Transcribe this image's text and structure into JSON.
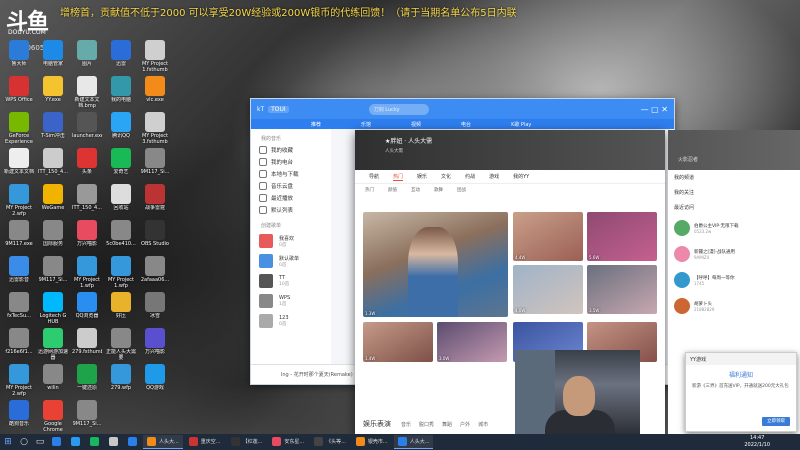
{
  "stream": {
    "logo_text": "斗鱼",
    "logo_sub": "DOUYU.COM",
    "view_count": "10605",
    "marquee": "增榜首，贡献值不低于2000 可以享受20W经验或200W银币的代练回馈！（请于当期名单公布5日内联"
  },
  "desktop_icons": [
    {
      "label": "鲁大师",
      "color": "#2b7bd8"
    },
    {
      "label": "电脑管家",
      "color": "#1d8ae8"
    },
    {
      "label": "图片",
      "color": "#6aa"
    },
    {
      "label": "迅雷",
      "color": "#2a6dd8"
    },
    {
      "label": "MY Project 1.fsthumb",
      "color": "#cfcfcf"
    },
    {
      "label": "WPS Office",
      "color": "#d63232"
    },
    {
      "label": "YY.exe",
      "color": "#f4c430"
    },
    {
      "label": "新建文本文档.bmp",
      "color": "#e8e8e8"
    },
    {
      "label": "我的电脑",
      "color": "#39a"
    },
    {
      "label": "vlc.exe",
      "color": "#f28b1a"
    },
    {
      "label": "GeForce Experience",
      "color": "#76b900"
    },
    {
      "label": "T-Sim冲击",
      "color": "#3a64c8"
    },
    {
      "label": "launcher.exe",
      "color": "#555"
    },
    {
      "label": "腾讯QQ",
      "color": "#2aa4f4"
    },
    {
      "label": "MY Project 3.fsthumb",
      "color": "#cfcfcf"
    },
    {
      "label": "新建文本文档",
      "color": "#eee"
    },
    {
      "label": "ITT_150_4...",
      "color": "#ccc"
    },
    {
      "label": "头条",
      "color": "#d33"
    },
    {
      "label": "爱奇艺",
      "color": "#19b955"
    },
    {
      "label": "9M117_Si...",
      "color": "#888"
    },
    {
      "label": "MY Project 2.wfp",
      "color": "#3498db"
    },
    {
      "label": "WeGame",
      "color": "#f0b400"
    },
    {
      "label": "ITT_150_4...",
      "color": "#999"
    },
    {
      "label": "回收站",
      "color": "#ddd"
    },
    {
      "label": "战争雷霆",
      "color": "#b33"
    },
    {
      "label": "9M117.exe",
      "color": "#888"
    },
    {
      "label": "国际服务",
      "color": "#888"
    },
    {
      "label": "万兴喵影",
      "color": "#e84a5f"
    },
    {
      "label": "5c0be410...",
      "color": "#888"
    },
    {
      "label": "OBS Studio",
      "color": "#333"
    },
    {
      "label": "迅雷影音",
      "color": "#3b8be8"
    },
    {
      "label": "9M117_Si...",
      "color": "#888"
    },
    {
      "label": "MY Project 1.wfp",
      "color": "#3498db"
    },
    {
      "label": "MY Project 1.wfp",
      "color": "#3498db"
    },
    {
      "label": "2afaaa06...",
      "color": "#888"
    },
    {
      "label": "fxTecSu...",
      "color": "#888"
    },
    {
      "label": "Logitech G HUB",
      "color": "#00b8fc"
    },
    {
      "label": "QQ浏览器",
      "color": "#2a8ef0"
    },
    {
      "label": "好压",
      "color": "#e8b32a"
    },
    {
      "label": "冰雪",
      "color": "#777"
    },
    {
      "label": "f216e6f1...",
      "color": "#888"
    },
    {
      "label": "迅游网游加速器",
      "color": "#2ecc71"
    },
    {
      "label": "279.fsthumb",
      "color": "#ccc"
    },
    {
      "label": "正能人头大需要",
      "color": "#888"
    },
    {
      "label": "万兴喵影",
      "color": "#5a4fcf"
    },
    {
      "label": "MY Project 2.wfp",
      "color": "#3498db"
    },
    {
      "label": "wilin",
      "color": "#888"
    },
    {
      "label": "一键还原",
      "color": "#1fa34a"
    },
    {
      "label": "279.wfp",
      "color": "#3498db"
    },
    {
      "label": "QQ游戏",
      "color": "#1e9ae8"
    },
    {
      "label": "酷狗音乐",
      "color": "#2a6dd8"
    },
    {
      "label": "Google Chrome",
      "color": "#e94235"
    },
    {
      "label": "9M117_Si...",
      "color": "#888"
    }
  ],
  "music_window": {
    "app_name": "kT",
    "badge": "TOUI",
    "search_placeholder": "刀剑 Lucky",
    "top_tabs": [
      "推荐",
      "乐馆",
      "视频",
      "电台",
      "K歌 Play"
    ],
    "sidebar_header": "我的音乐",
    "sidebar_items": [
      "我的收藏",
      "我的电台",
      "本地与下载",
      "音乐云盘",
      "最近播放",
      "默认列表"
    ],
    "playlist_header": "创建歌单",
    "playlists": [
      {
        "title": "我喜欢",
        "sub": "0首",
        "color": "#e85a5a"
      },
      {
        "title": "默认歌单",
        "sub": "0首",
        "color": "#4a90e2"
      },
      {
        "title": "TT",
        "sub": "10首",
        "color": "#555"
      },
      {
        "title": "WPS",
        "sub": "1首",
        "color": "#888"
      },
      {
        "title": "123",
        "sub": "0首",
        "color": "#aaa"
      }
    ],
    "footer_song": "lng - 花开时那个夏天(Remake)"
  },
  "live_window": {
    "channel_title": "★胖妞 · 人头大需",
    "channel_sub": "人头大需",
    "main_tabs": [
      "导航",
      "热门",
      "娱乐",
      "文化",
      "约战",
      "游戏",
      "我的YY"
    ],
    "active_tab": "热门",
    "sub_tabs": [
      "热门",
      "颜值",
      "互动",
      "歌舞",
      "团战"
    ],
    "tiles": [
      {
        "caption": "4.4W",
        "color": "linear-gradient(150deg,#c9a08a,#9b5f54)"
      },
      {
        "caption": "5.6W",
        "color": "linear-gradient(150deg,#8e4a72,#c56090)"
      },
      {
        "caption": "4.0W",
        "color": "linear-gradient(150deg,#9fb3c7,#d1c4be)"
      },
      {
        "caption": "3.5W",
        "color": "linear-gradient(150deg,#6a6f7e,#c7a8b0)"
      },
      {
        "caption": "1.4W",
        "color": "linear-gradient(150deg,#c69b88,#7e5048)"
      },
      {
        "caption": "3.0W",
        "color": "linear-gradient(150deg,#5a4c70,#c59ab0)"
      },
      {
        "caption": "2.6W",
        "color": "linear-gradient(150deg,#3a54a0,#6c85d0)"
      },
      {
        "caption": "1.9W",
        "color": "linear-gradient(150deg,#c49484,#85504a)"
      }
    ],
    "big_tile_caption": "1.3W",
    "footer_title": "娱乐表演",
    "footer_tabs": [
      "音乐",
      "脱口秀",
      "舞蹈",
      "户外",
      "城市"
    ]
  },
  "right_panel": {
    "header": "火影忍者",
    "rows": [
      "我的频道",
      "我的关注",
      "最近访问"
    ],
    "users": [
      {
        "name": "伯爵公主VIP·无限下载",
        "meta": "0523.2w",
        "color": "#5a6"
      },
      {
        "name": "新疆之[漫]·战队通用",
        "meta": "9AMIZ4",
        "color": "#e8a"
      },
      {
        "name": "【呼呼】每周一等你",
        "meta": "1745",
        "color": "#39c"
      },
      {
        "name": "胡萝卜头",
        "meta": "21882829",
        "color": "#c63"
      }
    ]
  },
  "popup": {
    "app": "YY游戏",
    "title": "福利通知",
    "body": "新游《三界》首充送VIP，开通就送200元大礼包",
    "button": "立即领取"
  },
  "taskbar": {
    "items": [
      {
        "label": "",
        "color": "#2a7fe8",
        "active": false
      },
      {
        "label": "",
        "color": "#2a9af0",
        "active": false
      },
      {
        "label": "",
        "color": "#18b860",
        "active": false
      },
      {
        "label": "",
        "color": "#c8c8c8",
        "active": false
      },
      {
        "label": "",
        "color": "#2a7fe8",
        "active": false
      },
      {
        "label": "人头大...",
        "color": "#f28b1a",
        "active": true
      },
      {
        "label": "重庆空...",
        "color": "#c33",
        "active": false
      },
      {
        "label": "【红莲...",
        "color": "#333",
        "active": false
      },
      {
        "label": "安东星...",
        "color": "#e84a5f",
        "active": false
      },
      {
        "label": "《头等...",
        "color": "#444",
        "active": false
      },
      {
        "label": "银壳市...",
        "color": "#f28b1a",
        "active": false
      },
      {
        "label": "人头大...",
        "color": "#2a7fe8",
        "active": true
      }
    ],
    "time": "14:47",
    "date": "2022/1/10"
  }
}
